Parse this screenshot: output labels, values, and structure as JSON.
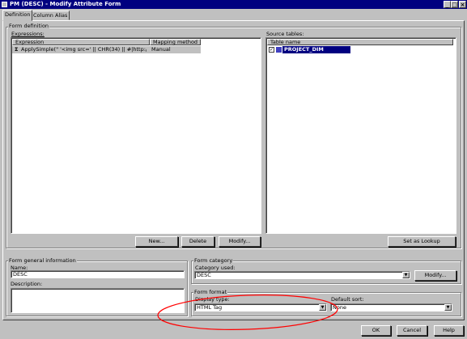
{
  "window": {
    "title": "PM (DESC) - Modify Attribute Form",
    "buttons": {
      "minimize": "_",
      "maximize": "□",
      "close": "×"
    }
  },
  "tabs": [
    {
      "label": "Definition",
      "active": true
    },
    {
      "label": "Column Alias",
      "active": false
    }
  ],
  "form_definition": {
    "label": "Form definition",
    "expressions_label": "Expressions:",
    "columns": [
      "Expression",
      "Mapping method"
    ],
    "rows": [
      {
        "icon": "Σ",
        "expression": "ApplySimple(\" '<img src=' || CHR(34) || #|http://localhost/...",
        "mapping": "Manual"
      }
    ],
    "buttons": {
      "new": "New...",
      "delete": "Delete",
      "modify": "Modify..."
    }
  },
  "source_tables": {
    "label": "Source tables:",
    "column": "Table name",
    "rows": [
      {
        "checked": true,
        "name": "PROJECT_DIM"
      }
    ],
    "set_as_lookup": "Set as Lookup"
  },
  "general": {
    "label": "Form general information",
    "name_label": "Name:",
    "name_value": "DESC",
    "description_label": "Description:"
  },
  "category": {
    "label": "Form category",
    "used_label": "Category used:",
    "used_value": "DESC",
    "modify": "Modify..."
  },
  "format": {
    "label": "Form format",
    "display_type_label": "Display type:",
    "display_type_value": "HTML Tag",
    "default_sort_label": "Default sort:",
    "default_sort_value": "None"
  },
  "footer": {
    "ok": "OK",
    "cancel": "Cancel",
    "help": "Help"
  },
  "annotation_color": "#ff0000"
}
